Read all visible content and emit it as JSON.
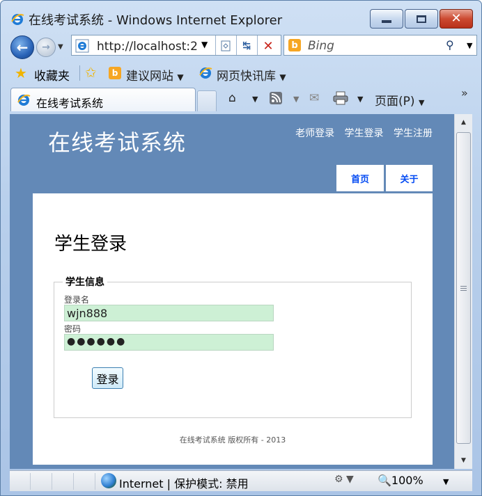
{
  "window": {
    "title": "在线考试系统 - Windows Internet Explorer",
    "min_glyph": "",
    "close_glyph": "✕"
  },
  "nav": {
    "back_glyph": "←",
    "forward_glyph": "→",
    "address": "http://localhost:2",
    "search_engine": "Bing",
    "search_engine_glyph": "b"
  },
  "favorites": {
    "label": "收藏夹",
    "suggested_sites": "建议网站",
    "web_slice": "网页快讯库"
  },
  "tabs": [
    {
      "label": "在线考试系统"
    }
  ],
  "commands": {
    "page_menu": "页面(P)",
    "chevron": "»"
  },
  "site": {
    "title": "在线考试系统",
    "links": [
      "老师登录",
      "学生登录",
      "学生注册"
    ],
    "menu": {
      "home": "首页",
      "about": "关于"
    },
    "page_title": "学生登录",
    "fieldset_legend": "学生信息",
    "username_label": "登录名",
    "username_value": "wjn888",
    "password_label": "密码",
    "password_value": "●●●●●●",
    "login_button": "登录",
    "footer": "在线考试系统 版权所有 - 2013"
  },
  "status": {
    "zone": "Internet | 保护模式: 禁用",
    "zoom": "100%"
  },
  "icons": {
    "ie_logo": "ie-logo-icon",
    "favorites_star": "favorites-star-icon",
    "globe": "globe-icon"
  },
  "colors": {
    "site_background": "#6389b7",
    "input_background": "#cdf0d5",
    "menu_text": "#034af3"
  }
}
